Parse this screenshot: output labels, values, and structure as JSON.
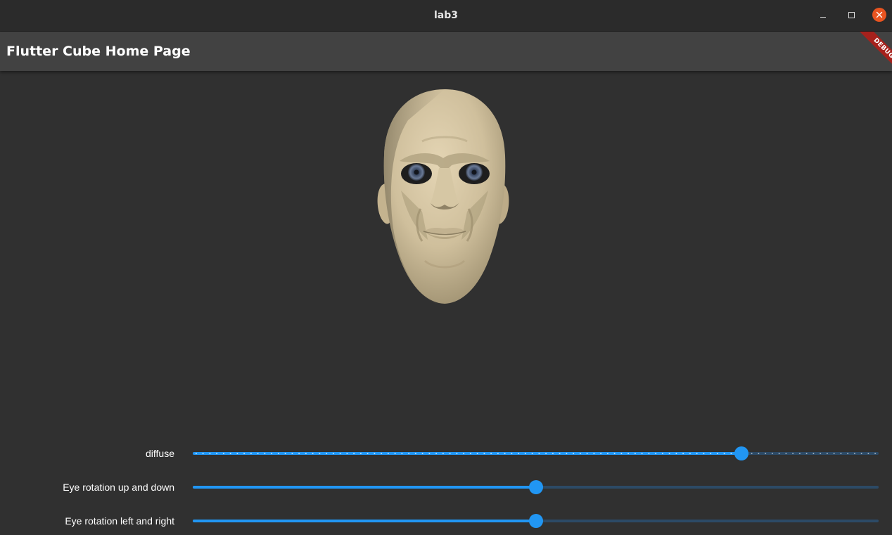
{
  "window": {
    "title": "lab3"
  },
  "appbar": {
    "title": "Flutter Cube Home Page",
    "debug_banner": "DEBUG"
  },
  "viewport": {
    "model": "3D head model with eyes",
    "skin_color": "#d8c9a8",
    "iris_color": "#4a5a78"
  },
  "sliders": [
    {
      "id": "diffuse",
      "label": "diffuse",
      "value": 0.8,
      "ticks": true
    },
    {
      "id": "eye-up-down",
      "label": "Eye rotation up and down",
      "value": 0.5,
      "ticks": false
    },
    {
      "id": "eye-left-right",
      "label": "Eye rotation left and right",
      "value": 0.5,
      "ticks": false
    }
  ],
  "colors": {
    "accent": "#2196f3",
    "inactive_track": "#2c4a66",
    "background": "#303030",
    "appbar": "#424242",
    "close_button": "#e95420"
  },
  "icons": {
    "minimize": "minimize-icon",
    "maximize": "maximize-icon",
    "close": "close-icon"
  }
}
